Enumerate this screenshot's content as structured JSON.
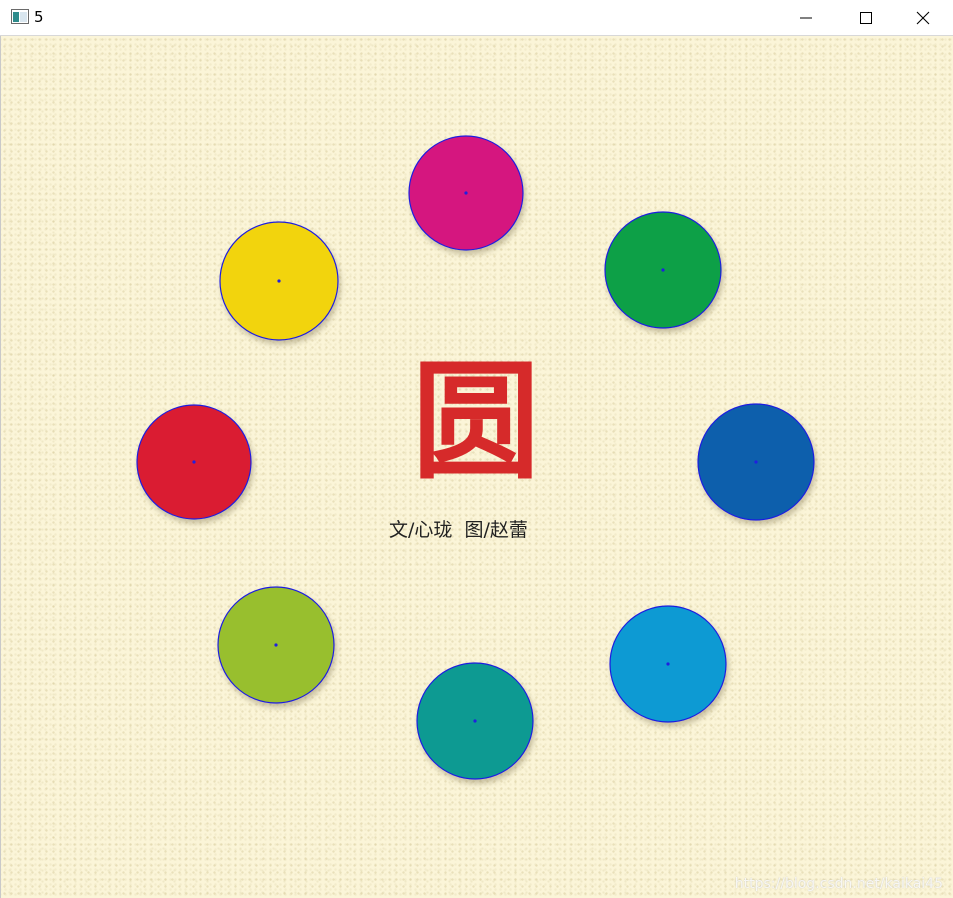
{
  "window": {
    "title": "5",
    "controls": {
      "minimize_icon": "minimize-icon",
      "maximize_icon": "maximize-icon",
      "close_icon": "close-icon"
    }
  },
  "poster": {
    "glyph": "圆",
    "glyph_color": "#d62a2a",
    "caption": "文/心珑  图/赵蕾",
    "outline_color": "#1f1fe0",
    "circles": [
      {
        "name": "circle-magenta",
        "color": "#d5187f"
      },
      {
        "name": "circle-green",
        "color": "#08a046"
      },
      {
        "name": "circle-blue",
        "color": "#0a5fac"
      },
      {
        "name": "circle-cyan",
        "color": "#0a9ad3"
      },
      {
        "name": "circle-teal",
        "color": "#0d9a92"
      },
      {
        "name": "circle-yellow-green",
        "color": "#98bf2d"
      },
      {
        "name": "circle-red",
        "color": "#da1c32"
      },
      {
        "name": "circle-yellow",
        "color": "#f2d40c"
      }
    ]
  },
  "watermark": "https://blog.csdn.net/kaikai45"
}
